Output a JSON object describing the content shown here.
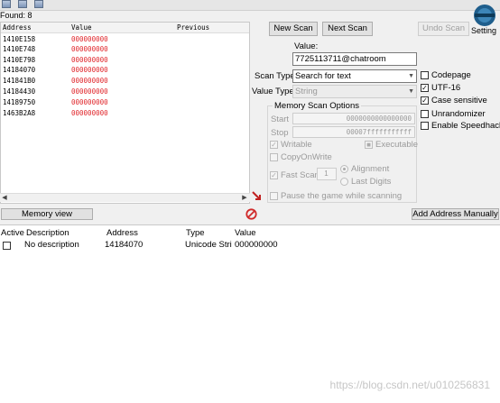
{
  "found_label": "Found: 8",
  "list": {
    "headers": [
      "Address",
      "Value",
      "Previous"
    ],
    "rows": [
      {
        "address": "1410E158",
        "value": "000000000"
      },
      {
        "address": "1410E748",
        "value": "000000000"
      },
      {
        "address": "1410E798",
        "value": "000000000"
      },
      {
        "address": "14184070",
        "value": "000000000"
      },
      {
        "address": "141841B0",
        "value": "000000000"
      },
      {
        "address": "14184430",
        "value": "000000000"
      },
      {
        "address": "14189750",
        "value": "000000000"
      },
      {
        "address": "1463B2A8",
        "value": "000000000"
      }
    ]
  },
  "buttons": {
    "new_scan": "New Scan",
    "next_scan": "Next Scan",
    "undo_scan": "Undo Scan",
    "settings": "Setting",
    "memory_view": "Memory view",
    "add_address": "Add Address Manually"
  },
  "scan": {
    "value_label": "Value:",
    "value_text": "7725113711@chatroom",
    "scan_type_label": "Scan Type",
    "scan_type_value": "Search for text",
    "value_type_label": "Value Type",
    "value_type_value": "String"
  },
  "memory_options": {
    "title": "Memory Scan Options",
    "start_label": "Start",
    "start_value": "0000000000000000",
    "stop_label": "Stop",
    "stop_value": "00007fffffffffff",
    "writable": "Writable",
    "executable": "Executable",
    "copy_on_write": "CopyOnWrite",
    "fast_scan": "Fast Scan",
    "fast_scan_value": "1",
    "alignment": "Alignment",
    "last_digits": "Last Digits",
    "pause": "Pause the game while scanning"
  },
  "right_options": {
    "codepage": "Codepage",
    "utf16": "UTF-16",
    "case_sensitive": "Case sensitive",
    "unrandomizer": "Unrandomizer",
    "speedhack": "Enable Speedhack"
  },
  "table": {
    "headers": [
      "Active",
      "Description",
      "Address",
      "Type",
      "Value"
    ],
    "row": {
      "description": "No description",
      "address": "14184070",
      "type": "Unicode Stri",
      "value": "000000000"
    }
  },
  "watermark": "https://blog.csdn.net/u010256831",
  "colors": {
    "value_red": "#e0262b",
    "panel_bg": "#f0f0f0"
  }
}
